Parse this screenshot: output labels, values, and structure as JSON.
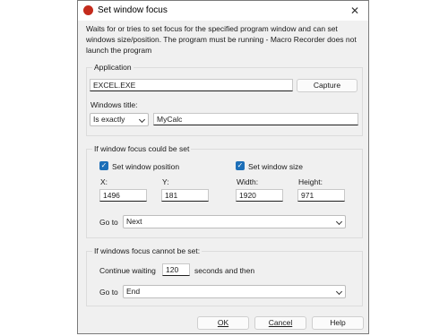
{
  "window": {
    "title": "Set window focus",
    "description_lines": [
      "Waits for or tries to set focus for the specified program window and can set",
      "windows size/position. The program must be running - Macro Recorder does not",
      "launch the program"
    ]
  },
  "application": {
    "group_label": "Application",
    "exe_value": "EXCEL.EXE",
    "capture_label": "Capture",
    "windows_title_label": "Windows title:",
    "match_mode": "Is exactly",
    "title_value": "MyCalc"
  },
  "focus_set": {
    "group_label": "If window focus could be set",
    "set_position_label": "Set window position",
    "set_position_checked": true,
    "set_size_label": "Set window size",
    "set_size_checked": true,
    "x_label": "X:",
    "x_value": "1496",
    "y_label": "Y:",
    "y_value": "181",
    "width_label": "Width:",
    "width_value": "1920",
    "height_label": "Height:",
    "height_value": "971",
    "goto_label": "Go to",
    "goto_value": "Next"
  },
  "focus_fail": {
    "group_label": "If windows focus cannot be set:",
    "continue_label": "Continue waiting",
    "wait_value": "120",
    "seconds_label": "seconds and then",
    "goto_label": "Go to",
    "goto_value": "End"
  },
  "buttons": {
    "ok_label": "OK",
    "cancel_label": "Cancel",
    "help_label": "Help"
  }
}
